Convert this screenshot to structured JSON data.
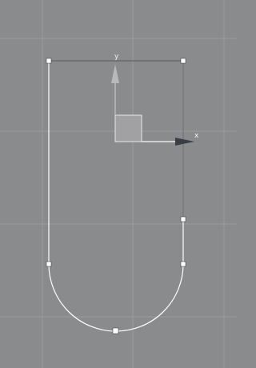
{
  "viewport": {
    "background_color": "#8a8b8d",
    "grid_color": "#9a9b9d",
    "shape_line_color": "#ffffff",
    "selected_edge_color": "#555a60",
    "vertex_color": "#ffffff"
  },
  "gizmo": {
    "x_label": "x",
    "y_label": "y",
    "x_axis_color": "#3a3e44",
    "y_axis_color": "#b7b9bc",
    "plane_color": "#a4a5a7",
    "plane_outline_color": "#e8e8e8"
  }
}
